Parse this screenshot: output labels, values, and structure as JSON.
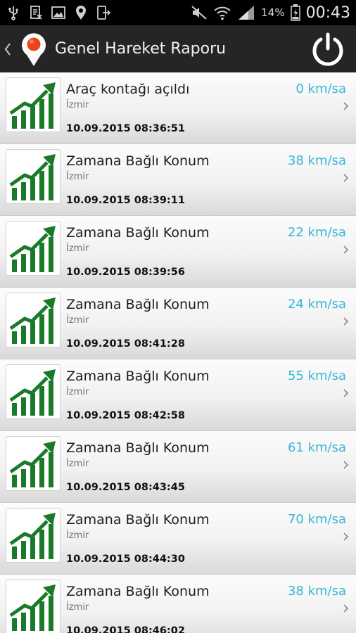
{
  "status_bar": {
    "battery_percent": "14%",
    "time": "00:43",
    "icons": [
      "usb-icon",
      "download-complete-icon",
      "image-icon",
      "location-pin-icon",
      "share-export-icon",
      "mute-icon",
      "wifi-icon",
      "signal-icon",
      "battery-icon"
    ]
  },
  "header": {
    "title": "Genel Hareket Raporu",
    "icons": [
      "back-chevron-icon",
      "app-location-logo-icon",
      "power-icon"
    ]
  },
  "events": [
    {
      "title": "Araç kontağı açıldı",
      "city": "İzmir",
      "datetime": "10.09.2015 08:36:51",
      "speed": "0 km/sa"
    },
    {
      "title": "Zamana Bağlı Konum",
      "city": "İzmir",
      "datetime": "10.09.2015 08:39:11",
      "speed": "38 km/sa"
    },
    {
      "title": "Zamana Bağlı Konum",
      "city": "İzmir",
      "datetime": "10.09.2015 08:39:56",
      "speed": "22 km/sa"
    },
    {
      "title": "Zamana Bağlı Konum",
      "city": "İzmir",
      "datetime": "10.09.2015 08:41:28",
      "speed": "24 km/sa"
    },
    {
      "title": "Zamana Bağlı Konum",
      "city": "İzmir",
      "datetime": "10.09.2015 08:42:58",
      "speed": "55 km/sa"
    },
    {
      "title": "Zamana Bağlı Konum",
      "city": "İzmir",
      "datetime": "10.09.2015 08:43:45",
      "speed": "61 km/sa"
    },
    {
      "title": "Zamana Bağlı Konum",
      "city": "İzmir",
      "datetime": "10.09.2015 08:44:30",
      "speed": "70 km/sa"
    },
    {
      "title": "Zamana Bağlı Konum",
      "city": "İzmir",
      "datetime": "10.09.2015 08:46:02",
      "speed": "38 km/sa"
    }
  ],
  "colors": {
    "speed_text": "#37b6d8",
    "chart_icon_green": "#1b7a2a",
    "logo_orange": "#e8461c",
    "action_bar": "#252525",
    "status_bar": "#000000"
  }
}
